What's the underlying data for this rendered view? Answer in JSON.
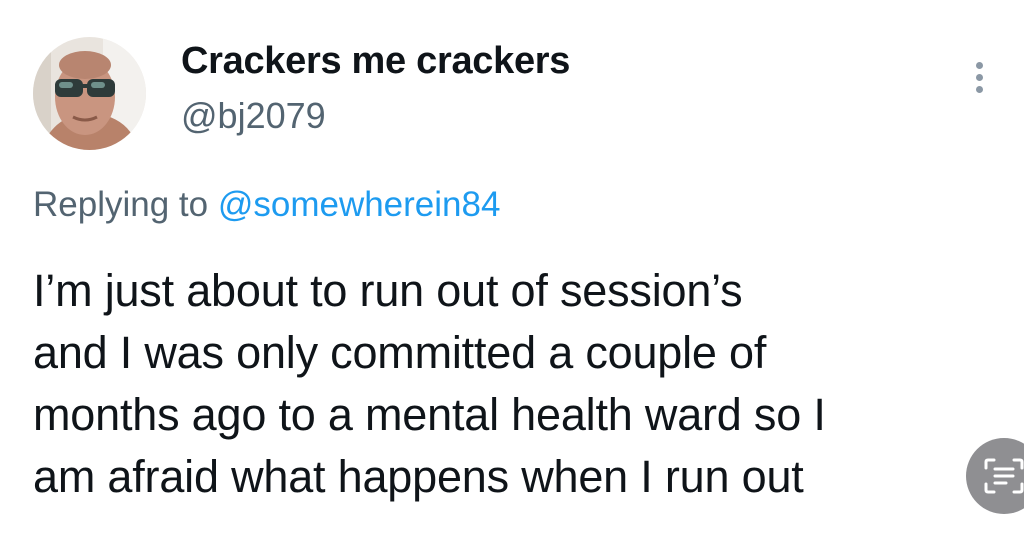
{
  "user": {
    "display_name": "Crackers me crackers",
    "handle": "@bj2079",
    "avatar_icon": "profile-photo"
  },
  "reply": {
    "prefix": "Replying to ",
    "mention": "@somewherein84"
  },
  "tweet": {
    "text": "I’m just about to run out of session’s\nand I was only committed a couple of\nmonths ago to a mental health ward so I\nam afraid what happens when I run out"
  },
  "icons": {
    "more": "more-vertical-icon",
    "scan": "text-scan-icon"
  },
  "colors": {
    "text": "#0f1419",
    "secondary": "#536471",
    "link": "#1d9bf0",
    "background": "#ffffff"
  }
}
